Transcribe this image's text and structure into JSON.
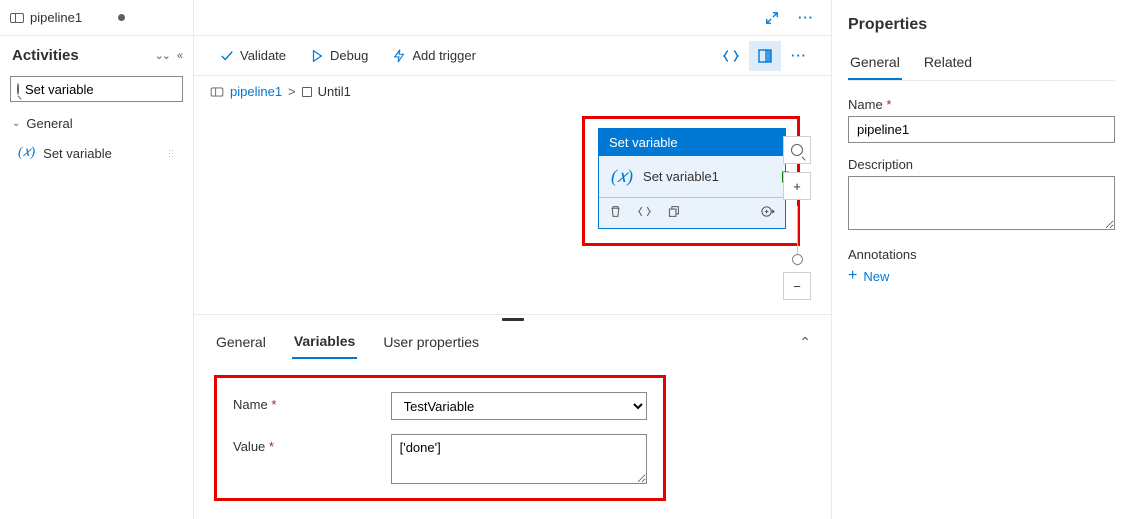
{
  "tab": {
    "title": "pipeline1"
  },
  "sidebar": {
    "title": "Activities",
    "search_value": "Set variable",
    "group_label": "General",
    "item_label": "Set variable"
  },
  "toolbar": {
    "validate": "Validate",
    "debug": "Debug",
    "trigger": "Add trigger"
  },
  "breadcrumb": {
    "root": "pipeline1",
    "child": "Until1"
  },
  "activity": {
    "type": "Set variable",
    "name": "Set variable1"
  },
  "bottom": {
    "tabs": {
      "general": "General",
      "variables": "Variables",
      "userprops": "User properties"
    },
    "name_label": "Name",
    "value_label": "Value",
    "name_value": "TestVariable",
    "value_value": "['done']"
  },
  "properties": {
    "title": "Properties",
    "tabs": {
      "general": "General",
      "related": "Related"
    },
    "name_label": "Name",
    "name_value": "pipeline1",
    "desc_label": "Description",
    "desc_value": "",
    "annotations_label": "Annotations",
    "new_label": "New"
  }
}
